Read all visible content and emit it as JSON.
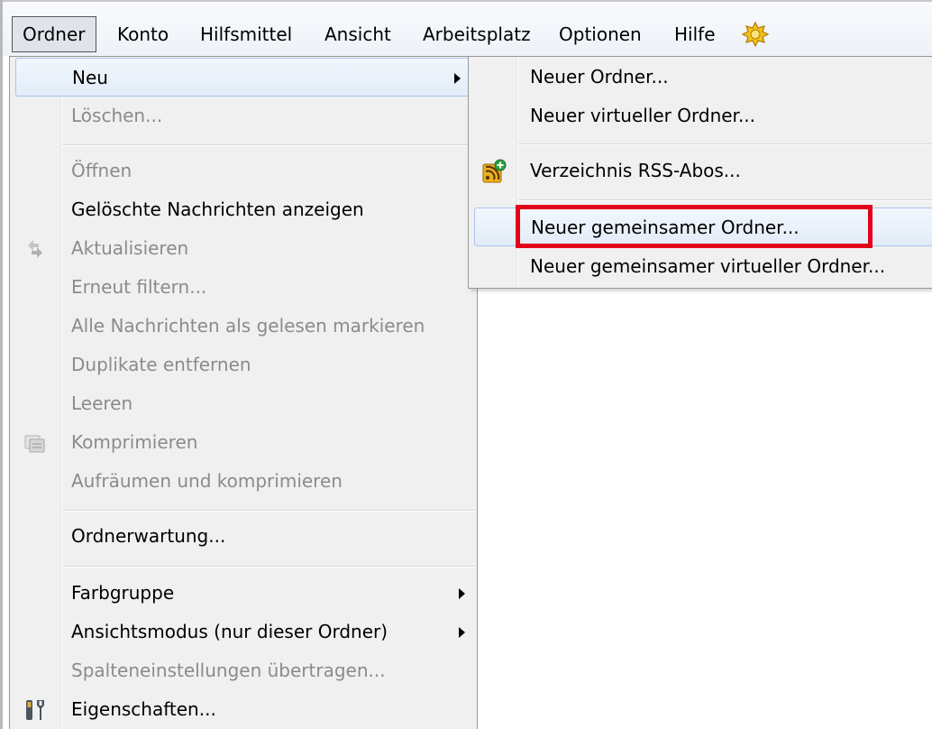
{
  "menubar": {
    "items": [
      "Ordner",
      "Konto",
      "Hilfsmittel",
      "Ansicht",
      "Arbeitsplatz",
      "Optionen",
      "Hilfe"
    ],
    "active_index": 0,
    "extra_icon": "sun-badge-icon"
  },
  "ordner_menu": {
    "items": [
      {
        "label": "Neu",
        "enabled": true,
        "submenu": true,
        "highlighted": true
      },
      {
        "label": "Löschen...",
        "enabled": false
      },
      {
        "label": "Öffnen",
        "enabled": false
      },
      {
        "label": "Gelöschte Nachrichten anzeigen",
        "enabled": true
      },
      {
        "label": "Aktualisieren",
        "enabled": false,
        "icon": "refresh-icon"
      },
      {
        "label": "Erneut filtern...",
        "enabled": false
      },
      {
        "label": "Alle Nachrichten als gelesen markieren",
        "enabled": false
      },
      {
        "label": "Duplikate entfernen",
        "enabled": false
      },
      {
        "label": "Leeren",
        "enabled": false
      },
      {
        "label": "Komprimieren",
        "enabled": false,
        "icon": "compress-icon"
      },
      {
        "label": "Aufräumen und komprimieren",
        "enabled": false
      },
      {
        "label": "Ordnerwartung...",
        "enabled": true
      },
      {
        "label": "Farbgruppe",
        "enabled": true,
        "submenu": true
      },
      {
        "label": "Ansichtsmodus (nur dieser Ordner)",
        "enabled": true,
        "submenu": true
      },
      {
        "label": "Spalteneinstellungen übertragen...",
        "enabled": false
      },
      {
        "label": "Eigenschaften...",
        "enabled": true,
        "icon": "properties-icon"
      }
    ]
  },
  "neu_submenu": {
    "items": [
      {
        "label": "Neuer Ordner..."
      },
      {
        "label": "Neuer virtueller Ordner..."
      },
      {
        "label": "Verzeichnis RSS-Abos...",
        "icon": "rss-add-icon"
      },
      {
        "label": "Neuer gemeinsamer Ordner...",
        "highlighted": true,
        "marked": true
      },
      {
        "label": "Neuer gemeinsamer virtueller Ordner..."
      }
    ]
  },
  "colors": {
    "highlight_box": "#e3001b",
    "menu_background": "#f0f0f0",
    "disabled_text": "#8b8b8b"
  }
}
